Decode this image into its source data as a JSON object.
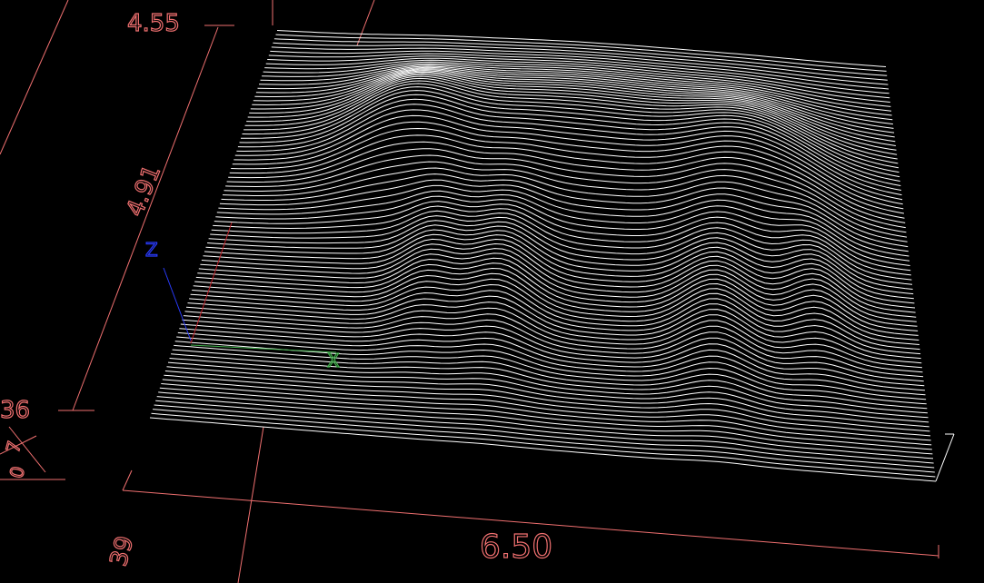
{
  "dimensions": {
    "height_top": "4.55",
    "height_mid": "4.91",
    "left_partial": "36",
    "width": "6.50",
    "depth_partial": "39",
    "corner_partial_a": "7",
    "corner_partial_b": "0"
  },
  "axes": {
    "z_label": "Z",
    "x_label": "X"
  },
  "colors": {
    "background": "#000000",
    "dimension": "#f07070",
    "mesh": "#ffffff",
    "z_axis": "#2a3cff",
    "x_axis": "#3fae4a",
    "y_axis": "#c0202a",
    "grid": "#f07070"
  }
}
